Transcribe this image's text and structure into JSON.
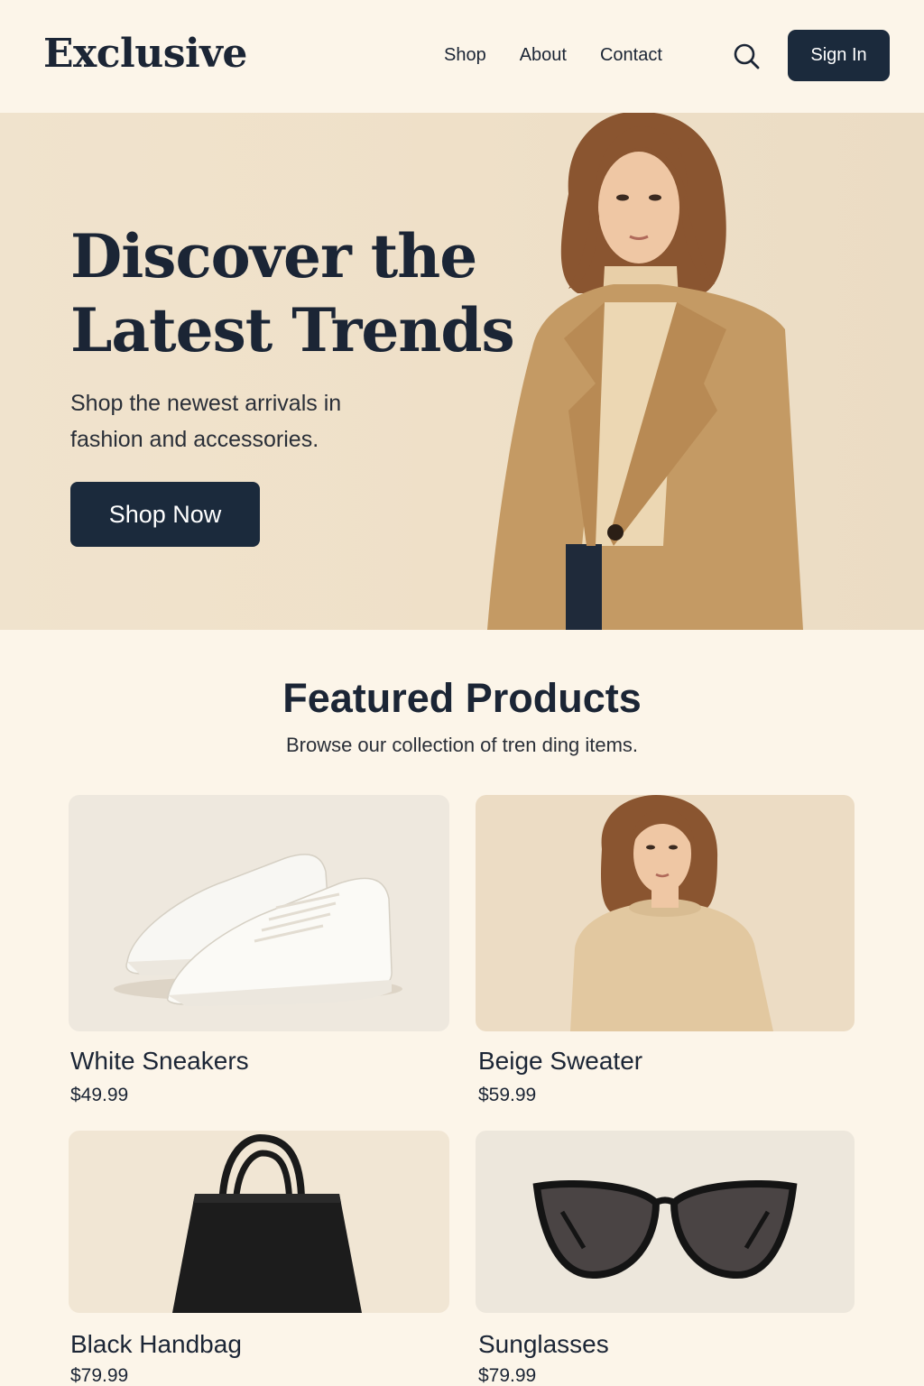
{
  "header": {
    "logo": "Exclusive",
    "nav": [
      "Shop",
      "About",
      "Contact"
    ],
    "search_icon": "search-icon",
    "signin_label": "Sign In"
  },
  "hero": {
    "title_line1": "Discover the",
    "title_line2": "Latest Trends",
    "subtitle_line1": "Shop the newest arrivals in",
    "subtitle_line2": "fashion and accessories.",
    "cta_label": "Shop Now"
  },
  "featured": {
    "title": "Featured Products",
    "subtitle": "Browse our collection of tren ding items.",
    "products": [
      {
        "name": "White Sneakers",
        "price": "$49.99"
      },
      {
        "name": "Beige Sweater",
        "price": "$59.99"
      },
      {
        "name": "Black Handbag",
        "price": "$79.99"
      },
      {
        "name": "Sunglasses",
        "price": "$79.99"
      }
    ]
  },
  "colors": {
    "background": "#fcf5e9",
    "primary_dark": "#1b2a3c",
    "hero_bg": "#efe0c8",
    "coat": "#c49a64"
  }
}
